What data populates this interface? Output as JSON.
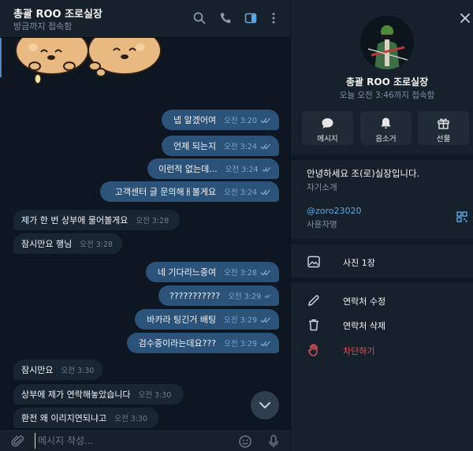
{
  "chat": {
    "title": "총괄 ROO 조로실장",
    "status": "방금까지 접속함",
    "composer_placeholder": "메시지 작성...",
    "messages": [
      {
        "dir": "out",
        "text": "넵 알겠어여",
        "time": "오전 3:20"
      },
      {
        "dir": "out",
        "text": "언제 되는지",
        "time": "오전 3:24"
      },
      {
        "dir": "out",
        "text": "이런적 없는데...",
        "time": "오전 3:24"
      },
      {
        "dir": "out",
        "text": "고객센터 글 문의해ㅐ볼게요",
        "time": "오전 3:24"
      },
      {
        "dir": "in",
        "text": "제가 한 번 상부에 물어볼게요",
        "time": "오전 3:28"
      },
      {
        "dir": "in",
        "text": "잠시만요 행님",
        "time": "오전 3:28"
      },
      {
        "dir": "out",
        "text": "네 기다리느중여",
        "time": "오전 3:28"
      },
      {
        "dir": "out",
        "text": "???????????",
        "time": "오전 3:29"
      },
      {
        "dir": "out",
        "text": "바카라 팅긴거 배팅",
        "time": "오전 3:29"
      },
      {
        "dir": "out",
        "text": "검수중이라는데요???",
        "time": "오전 3:29"
      },
      {
        "dir": "in",
        "text": "잠시만요",
        "time": "오전 3:30"
      },
      {
        "dir": "in",
        "text": "상부에 제가 연락해놓았습니다",
        "time": "오전 3:30"
      },
      {
        "dir": "in",
        "text": "환전 왜 이리지연되냐고",
        "time": "오전 3:30"
      }
    ]
  },
  "profile": {
    "name": "총괄 ROO 조로실장",
    "last_seen": "오늘 오전 3:46까지 접속함",
    "actions": [
      {
        "label": "메시지",
        "icon": "message-icon"
      },
      {
        "label": "음소거",
        "icon": "bell-icon"
      },
      {
        "label": "선물",
        "icon": "gift-icon"
      }
    ],
    "bio": "안녕하세요 조(로)실장입니다.",
    "bio_label": "자기소개",
    "username": "@zoro23020",
    "username_label": "사용자명",
    "media": "사진 1장",
    "edit_contact": "연락처 수정",
    "delete_contact": "연락처 삭제",
    "block": "차단하기"
  },
  "colors": {
    "out_bubble": "#2b5278",
    "in_bubble": "#182533",
    "chat_bg": "#0e1621",
    "panel_bg": "#17212b",
    "accent": "#5ea9e6",
    "danger": "#e0545a"
  }
}
